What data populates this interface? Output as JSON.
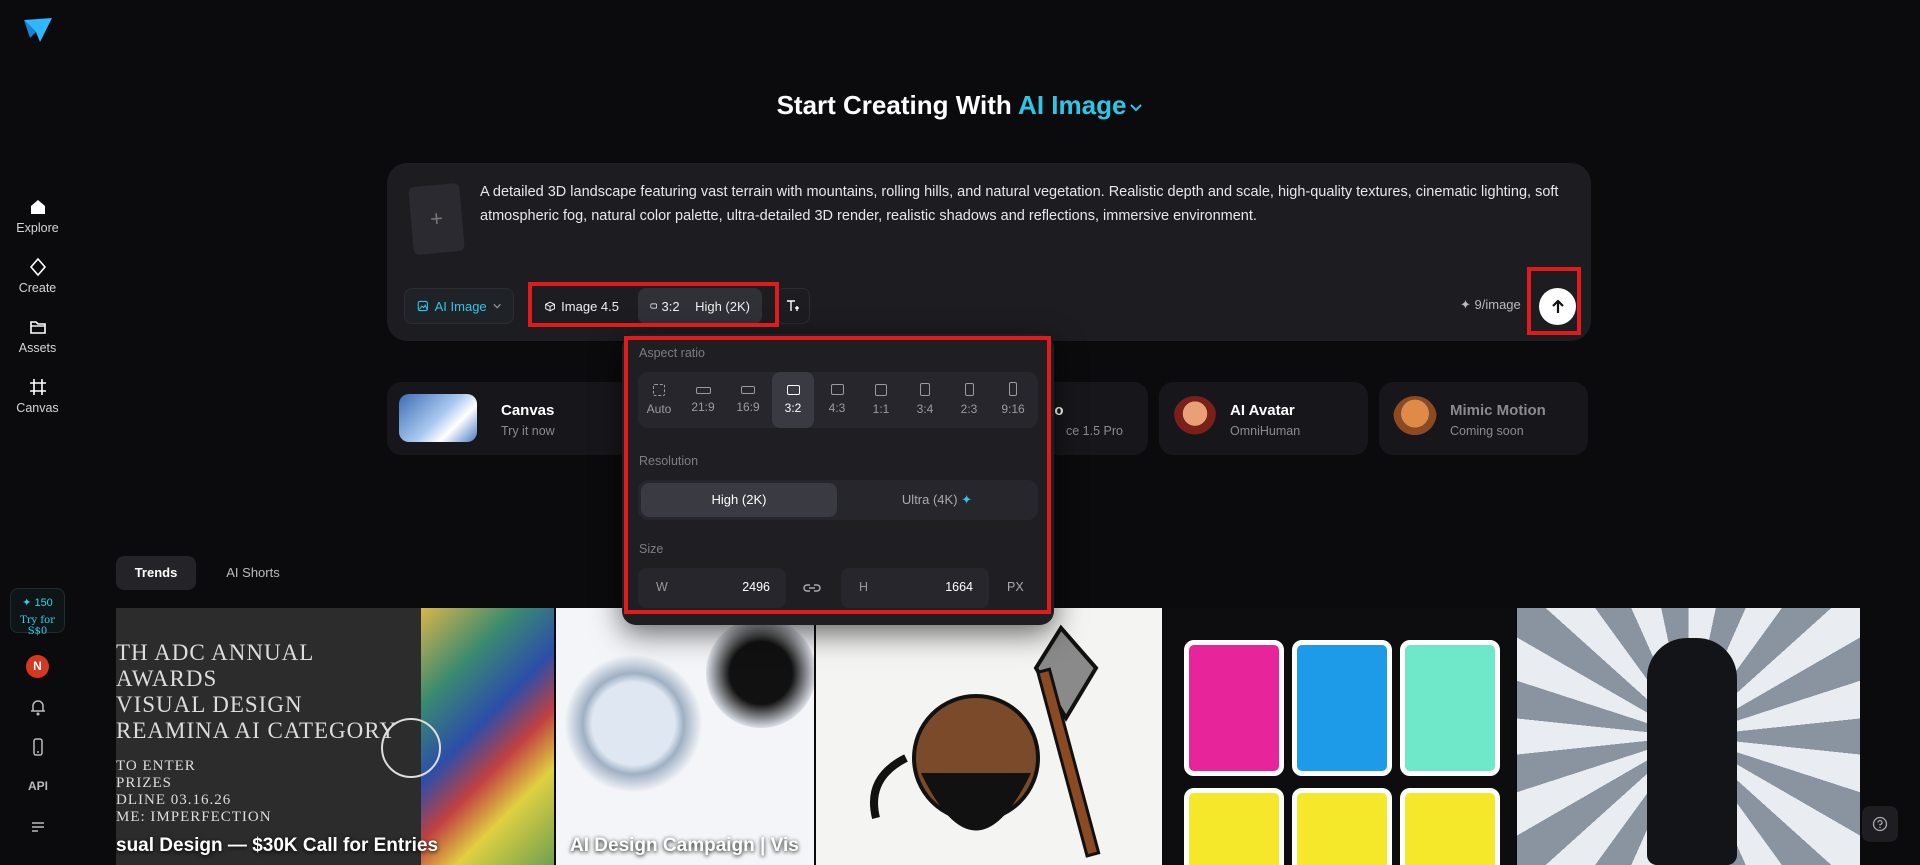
{
  "sidebar": {
    "nav": [
      {
        "label": "Explore",
        "icon": "home-icon"
      },
      {
        "label": "Create",
        "icon": "diamond-icon"
      },
      {
        "label": "Assets",
        "icon": "folder-icon"
      },
      {
        "label": "Canvas",
        "icon": "canvas-icon"
      }
    ],
    "credits": {
      "amount": "✦ 150",
      "cta": "Try for S$0"
    },
    "avatar_initial": "N",
    "api_label": "API"
  },
  "headline": {
    "prefix": "Start Creating With",
    "mode": "AI Image"
  },
  "prompt": {
    "text": "A detailed 3D landscape featuring vast terrain with mountains, rolling hills, and natural vegetation. Realistic depth and scale, high-quality textures, cinematic lighting, soft atmospheric fog, natural color palette, ultra-detailed 3D render, realistic shadows and reflections, immersive environment.",
    "add_reference": "+",
    "mode_pill": "AI Image",
    "model_pill": "Image 4.5",
    "ratio_pill": "3:2",
    "quality_pill": "High (2K)",
    "cost": "✦ 9/image"
  },
  "features": [
    {
      "title": "Canvas",
      "subtitle": "Try it now"
    },
    {
      "title": "eo",
      "subtitle": "ce 1.5 Pro"
    },
    {
      "title": "AI Avatar",
      "subtitle": "OmniHuman"
    },
    {
      "title": "Mimic Motion",
      "subtitle": "Coming soon"
    }
  ],
  "popup": {
    "aspect_label": "Aspect ratio",
    "ratios": [
      "Auto",
      "21:9",
      "16:9",
      "3:2",
      "4:3",
      "1:1",
      "3:4",
      "2:3",
      "9:16"
    ],
    "selected_ratio": "3:2",
    "resolution_label": "Resolution",
    "resolutions": [
      "High (2K)",
      "Ultra (4K)"
    ],
    "selected_resolution": "High (2K)",
    "size_label": "Size",
    "width_label": "W",
    "width": "2496",
    "height_label": "H",
    "height": "1664",
    "unit": "PX"
  },
  "tabs": [
    "Trends",
    "AI Shorts"
  ],
  "gallery": [
    {
      "caption": "sual Design — $30K Call for Entries",
      "poster": [
        "TH ADC ANNUAL AWARDS",
        "VISUAL DESIGN",
        "REAMINA AI CATEGORY",
        "TO ENTER",
        "PRIZES",
        "DLINE 03.16.26",
        "ME: IMPERFECTION"
      ]
    },
    {
      "caption": "AI Design Campaign | Vis"
    },
    {
      "caption": ""
    },
    {
      "caption": ""
    },
    {
      "caption": ""
    }
  ],
  "colors": {
    "accent": "#2fc6e6",
    "highlight": "#e01b1b",
    "background": "#0b0b0d"
  }
}
